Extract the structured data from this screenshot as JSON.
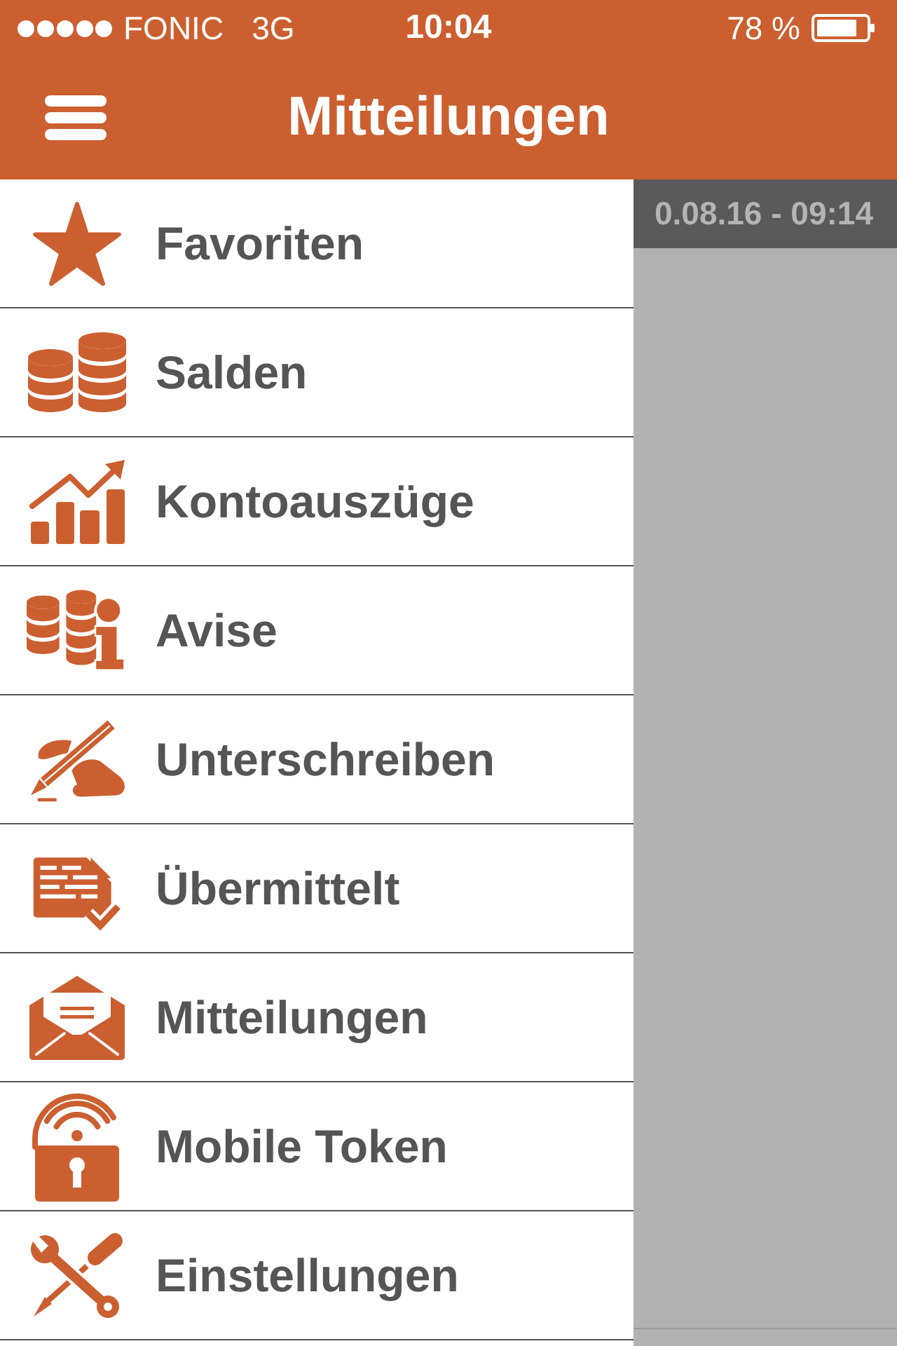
{
  "status_bar": {
    "carrier": "FONIC",
    "network": "3G",
    "time": "10:04",
    "battery": "78 %"
  },
  "nav_bar": {
    "title": "Mitteilungen"
  },
  "menu": {
    "items": [
      {
        "label": "Favoriten"
      },
      {
        "label": "Salden"
      },
      {
        "label": "Kontoauszüge"
      },
      {
        "label": "Avise"
      },
      {
        "label": "Unterschreiben"
      },
      {
        "label": "Übermittelt"
      },
      {
        "label": "Mitteilungen"
      },
      {
        "label": "Mobile Token"
      },
      {
        "label": "Einstellungen"
      }
    ]
  },
  "content": {
    "date_header": "0.08.16 - 09:14"
  }
}
